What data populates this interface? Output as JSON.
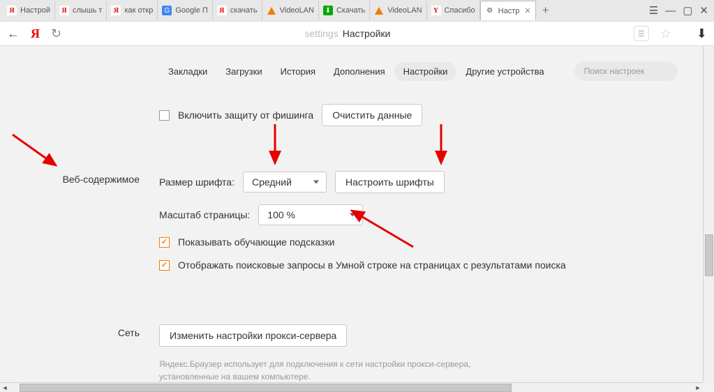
{
  "window": {
    "menu": "☰",
    "min": "—",
    "max": "▢",
    "close": "✕"
  },
  "tabs": [
    {
      "fav": "y",
      "label": "Настрой"
    },
    {
      "fav": "y",
      "label": "слышь т"
    },
    {
      "fav": "y",
      "label": "как откр"
    },
    {
      "fav": "g",
      "label": "Google П"
    },
    {
      "fav": "y",
      "label": "скачать"
    },
    {
      "fav": "vlc",
      "label": "VideoLAN"
    },
    {
      "fav": "dl",
      "label": "Скачать"
    },
    {
      "fav": "vlc",
      "label": "VideoLAN"
    },
    {
      "fav": "ya",
      "label": "Спасибо"
    },
    {
      "fav": "gear",
      "label": "Настр",
      "active": true
    }
  ],
  "addTab": "+",
  "address": {
    "back": "←",
    "logo": "Я",
    "reload": "↻",
    "prefix": "settings",
    "title": "Настройки",
    "download": "⬇"
  },
  "nav": {
    "items": [
      "Закладки",
      "Загрузки",
      "История",
      "Дополнения",
      "Настройки",
      "Другие устройства"
    ],
    "activeIndex": 4,
    "searchPlaceholder": "Поиск настроек"
  },
  "phishing": {
    "checkbox": "Включить защиту от фишинга",
    "clear": "Очистить данные"
  },
  "web": {
    "heading": "Веб-содержимое",
    "fontSizeLabel": "Размер шрифта:",
    "fontSizeValue": "Средний",
    "customizeFonts": "Настроить шрифты",
    "zoomLabel": "Масштаб страницы:",
    "zoomValue": "100 %",
    "hints": "Показывать обучающие подсказки",
    "smartline": "Отображать поисковые запросы в Умной строке на страницах с результатами поиска"
  },
  "net": {
    "heading": "Сеть",
    "proxyBtn": "Изменить настройки прокси-сервера",
    "note": "Яндекс.Браузер использует для подключения к сети настройки прокси-сервера, установленные на вашем компьютере."
  }
}
